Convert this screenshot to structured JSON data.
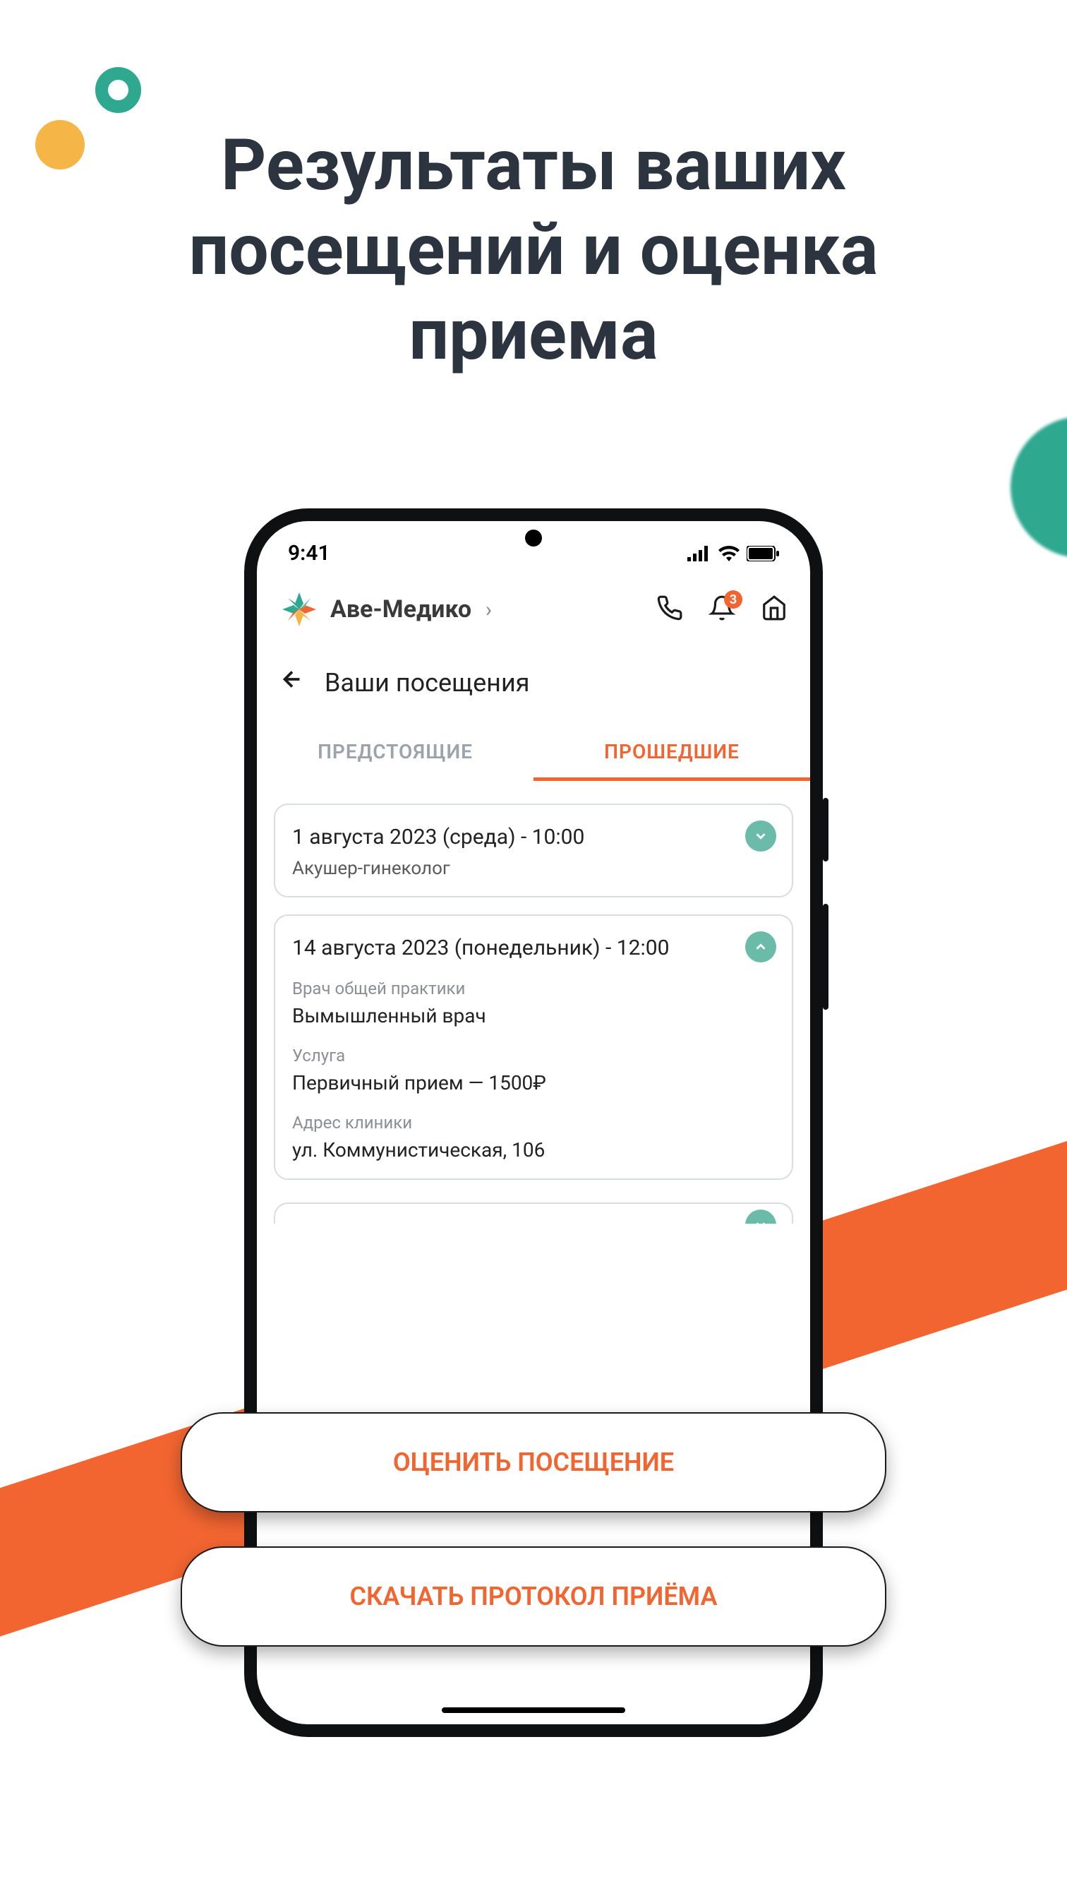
{
  "hero": {
    "title": "Результаты ваших посещений и оценка приема"
  },
  "statusBar": {
    "time": "9:41"
  },
  "header": {
    "brand": "Аве-Медико",
    "notificationCount": "3"
  },
  "pageNav": {
    "title": "Ваши посещения"
  },
  "tabs": {
    "upcoming": "ПРЕДСТОЯЩИЕ",
    "past": "ПРОШЕДШИЕ"
  },
  "visits": [
    {
      "datetime": "1 августа 2023 (среда) - 10:00",
      "specialty": "Акушер-гинеколог"
    },
    {
      "datetime": "14 августа 2023 (понедельник) - 12:00",
      "doctorRoleLabel": "Врач общей практики",
      "doctorName": "Вымышленный врач",
      "serviceLabel": "Услуга",
      "serviceValue": "Первичный прием — 1500₽",
      "addressLabel": "Адрес клиники",
      "addressValue": "ул. Коммунистическая, 106"
    }
  ],
  "actions": {
    "rate": "ОЦЕНИТЬ ПОСЕЩЕНИЕ",
    "download": "СКАЧАТЬ ПРОТОКОЛ ПРИЁМА"
  }
}
